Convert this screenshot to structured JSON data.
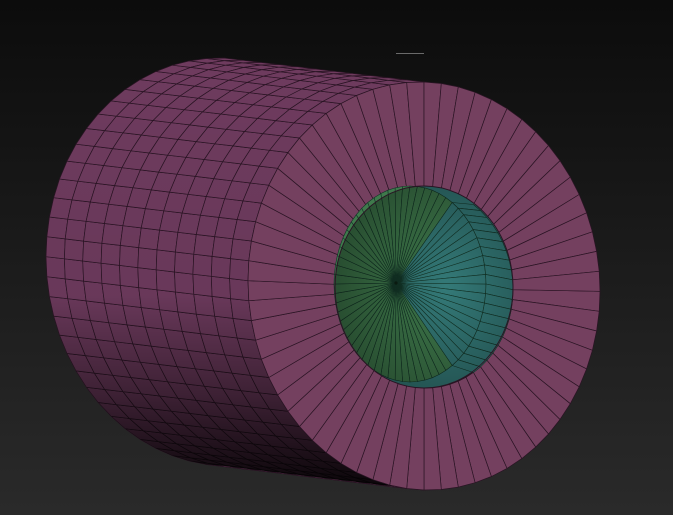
{
  "viewport": {
    "background_top": "#0c0c0c",
    "background_bottom": "#2a2a2a"
  },
  "mesh": {
    "object": "hollow-cylinder",
    "display": "polyframe",
    "radial_segments": 64,
    "length_segments": 11,
    "outer_color": "#6e3b5e",
    "outer_shadow_color": "#1c0c19",
    "cap_color": "#74405f",
    "wire_color": "#2a1424",
    "inner_green": "#3f7a4c",
    "inner_teal": "#347a78",
    "inner_wire": "#133527",
    "cap_pole": "outer-rim-only",
    "bore_depth": 1
  }
}
